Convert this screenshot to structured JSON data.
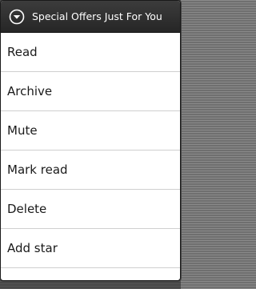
{
  "dialog": {
    "title": "Special Offers Just For You",
    "title_icon": "chevron-down-circle-icon"
  },
  "menu": {
    "items": [
      {
        "label": "Read"
      },
      {
        "label": "Archive"
      },
      {
        "label": "Mute"
      },
      {
        "label": "Mark read"
      },
      {
        "label": "Delete"
      },
      {
        "label": "Add star"
      }
    ]
  },
  "colors": {
    "title_bar": "#2e2e2e",
    "title_text": "#ffffff",
    "menu_bg": "#ffffff",
    "divider": "#cfcfcf"
  }
}
